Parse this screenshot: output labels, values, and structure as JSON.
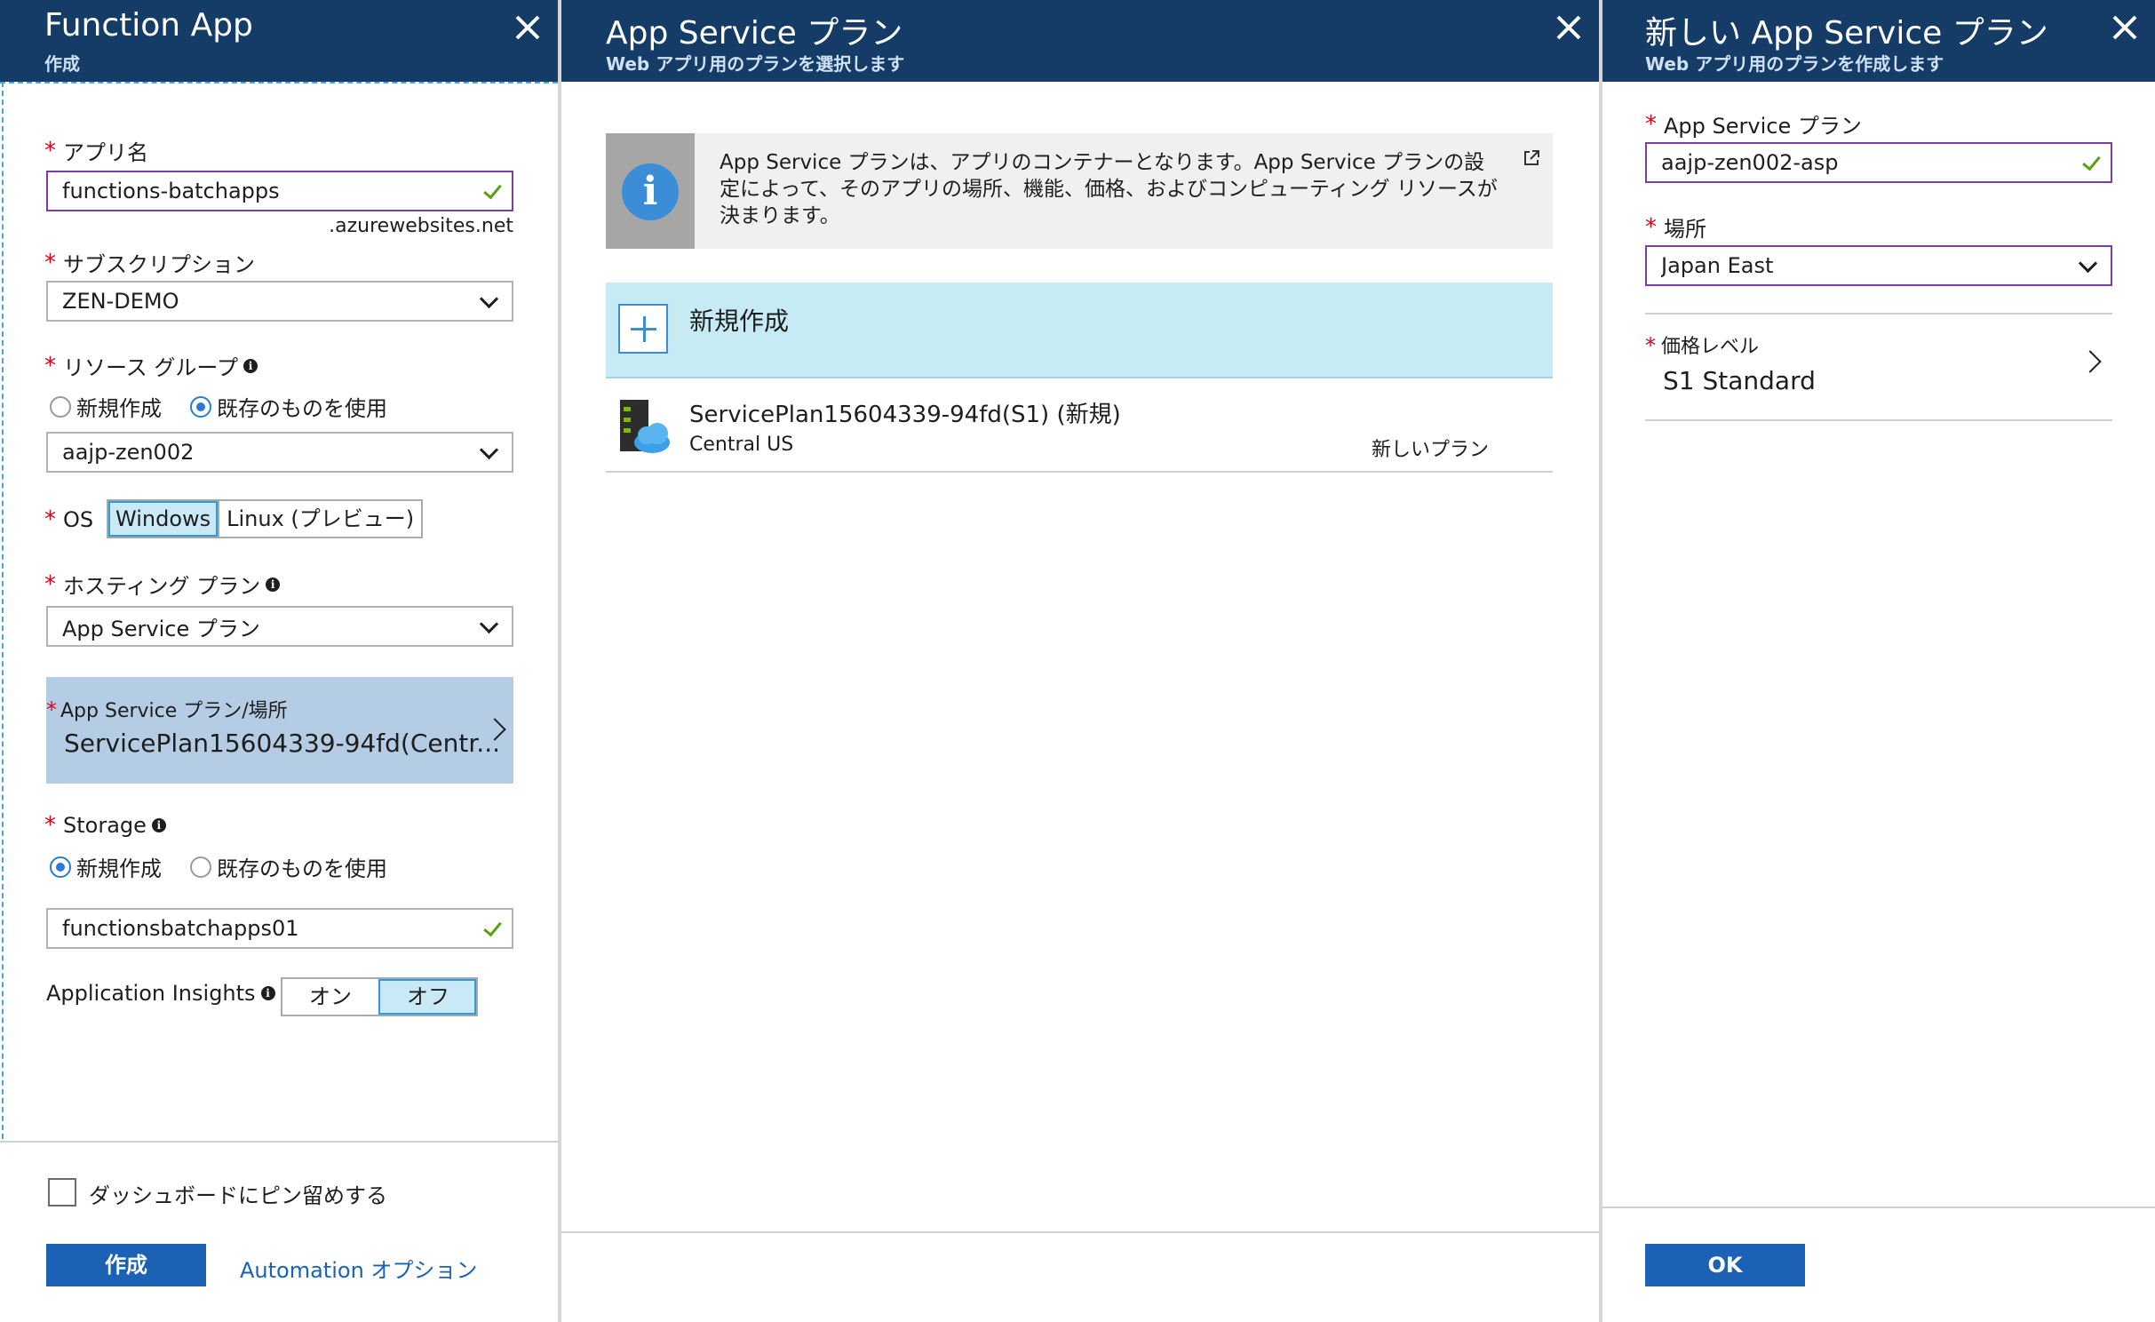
{
  "colors": {
    "header_bg": "#143c66",
    "accent": "#1b62b5",
    "valid_check": "#58a00c",
    "required": "#e0001b",
    "selected_segment": "#c9e9f7"
  },
  "blade1": {
    "title": "Function App",
    "subtitle": "作成",
    "app_name": {
      "label": "アプリ名",
      "value": "functions-batchapps",
      "suffix": ".azurewebsites.net"
    },
    "subscription": {
      "label": "サブスクリプション",
      "value": "ZEN-DEMO"
    },
    "resource_group": {
      "label": "リソース グループ",
      "options": [
        "新規作成",
        "既存のものを使用"
      ],
      "selected": "既存のものを使用",
      "value": "aajp-zen002"
    },
    "os": {
      "label": "OS",
      "options": [
        "Windows",
        "Linux (プレビュー)"
      ],
      "selected": "Windows"
    },
    "hosting_plan": {
      "label": "ホスティング プラン",
      "value": "App Service プラン"
    },
    "plan_location": {
      "label": "App Service プラン/場所",
      "value": "ServicePlan15604339-94fd(Centr..."
    },
    "storage": {
      "label": "Storage",
      "options": [
        "新規作成",
        "既存のものを使用"
      ],
      "selected": "新規作成",
      "value": "functionsbatchapps01"
    },
    "app_insights": {
      "label": "Application Insights",
      "options": [
        "オン",
        "オフ"
      ],
      "selected": "オフ"
    },
    "pin_dashboard": {
      "label": "ダッシュボードにピン留めする",
      "checked": false
    },
    "create_button": "作成",
    "automation_link": "Automation オプション"
  },
  "blade2": {
    "title": "App Service プラン",
    "subtitle": "Web アプリ用のプランを選択します",
    "info_text": "App Service プランは、アプリのコンテナーとなります。App Service プランの設定によって、そのアプリの場所、機能、価格、およびコンピューティング リソースが決まります。",
    "create_new": "新規作成",
    "plans": [
      {
        "name": "ServicePlan15604339-94fd(S1) (新規)",
        "location": "Central US",
        "tag": "新しいプラン"
      }
    ]
  },
  "blade3": {
    "title": "新しい App Service プラン",
    "subtitle": "Web アプリ用のプランを作成します",
    "plan_name": {
      "label": "App Service プラン",
      "value": "aajp-zen002-asp"
    },
    "location": {
      "label": "場所",
      "value": "Japan East"
    },
    "pricing_tier": {
      "label": "価格レベル",
      "value": "S1 Standard"
    },
    "ok_button": "OK"
  }
}
